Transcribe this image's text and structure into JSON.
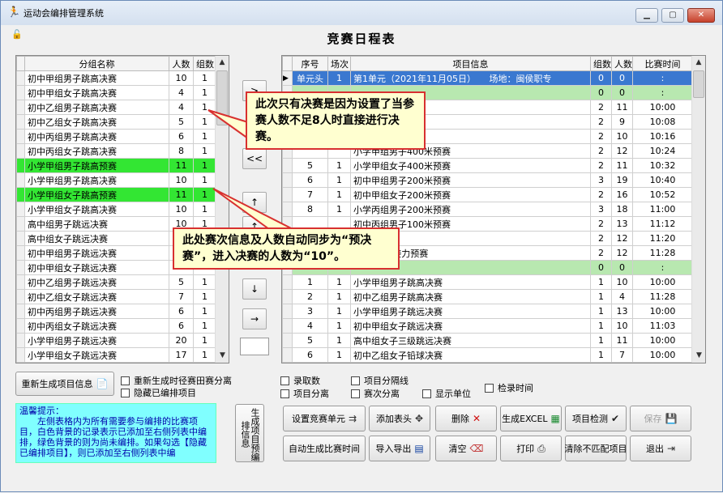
{
  "window": {
    "title": "运动会编排管理系统",
    "minimize": "▁",
    "maximize": "▢",
    "close": "✕",
    "lock": "🔓"
  },
  "heading": "竞赛日程表",
  "left_table": {
    "headers": [
      "分组名称",
      "人数",
      "组数"
    ],
    "rows": [
      {
        "name": "初中甲组男子跳高决赛",
        "count": "10",
        "groups": "1",
        "hl": ""
      },
      {
        "name": "初中甲组女子跳高决赛",
        "count": "4",
        "groups": "1",
        "hl": ""
      },
      {
        "name": "初中乙组男子跳高决赛",
        "count": "4",
        "groups": "1",
        "hl": ""
      },
      {
        "name": "初中乙组女子跳高决赛",
        "count": "5",
        "groups": "1",
        "hl": ""
      },
      {
        "name": "初中丙组男子跳高决赛",
        "count": "6",
        "groups": "1",
        "hl": ""
      },
      {
        "name": "初中丙组女子跳高决赛",
        "count": "8",
        "groups": "1",
        "hl": ""
      },
      {
        "name": "小学甲组男子跳高预赛",
        "count": "11",
        "groups": "1",
        "hl": "green"
      },
      {
        "name": "小学甲组男子跳高决赛",
        "count": "10",
        "groups": "1",
        "hl": ""
      },
      {
        "name": "小学甲组女子跳高预赛",
        "count": "11",
        "groups": "1",
        "hl": "green"
      },
      {
        "name": "小学甲组女子跳高决赛",
        "count": "10",
        "groups": "1",
        "hl": ""
      },
      {
        "name": "高中组男子跳远决赛",
        "count": "10",
        "groups": "1",
        "hl": ""
      },
      {
        "name": "高中组女子跳远决赛",
        "count": "",
        "groups": "",
        "hl": ""
      },
      {
        "name": "初中甲组男子跳远决赛",
        "count": "",
        "groups": "",
        "hl": ""
      },
      {
        "name": "初中甲组女子跳远决赛",
        "count": "",
        "groups": "",
        "hl": ""
      },
      {
        "name": "初中乙组男子跳远决赛",
        "count": "5",
        "groups": "1",
        "hl": ""
      },
      {
        "name": "初中乙组女子跳远决赛",
        "count": "7",
        "groups": "1",
        "hl": ""
      },
      {
        "name": "初中丙组男子跳远决赛",
        "count": "6",
        "groups": "1",
        "hl": ""
      },
      {
        "name": "初中丙组女子跳远决赛",
        "count": "6",
        "groups": "1",
        "hl": ""
      },
      {
        "name": "小学甲组男子跳远决赛",
        "count": "20",
        "groups": "1",
        "hl": ""
      },
      {
        "name": "小学甲组女子跳远决赛",
        "count": "17",
        "groups": "1",
        "hl": ""
      }
    ]
  },
  "move_buttons": [
    ">",
    "<<",
    "↑",
    "↑",
    "↓",
    "→"
  ],
  "right_table": {
    "headers": [
      "序号",
      "场次",
      "项目信息",
      "组数",
      "人数",
      "比赛时间"
    ],
    "rows": [
      {
        "no": "单元头",
        "session": "1",
        "info": "第1单元（2021年11月05日）　　场地：闽侯职专",
        "g": "0",
        "p": "0",
        "time": ":",
        "cls": "selrow",
        "marker": "▶"
      },
      {
        "no": "",
        "session": "",
        "info": "",
        "g": "0",
        "p": "0",
        "time": ":",
        "cls": "lightgreen",
        "marker": ""
      },
      {
        "no": "",
        "session": "",
        "info": "项全能[60米]决赛",
        "g": "2",
        "p": "11",
        "time": "10:00",
        "cls": "",
        "marker": ""
      },
      {
        "no": "",
        "session": "",
        "info": "项全能[60米]决赛",
        "g": "2",
        "p": "9",
        "time": "10:08",
        "cls": "",
        "marker": ""
      },
      {
        "no": "",
        "session": "",
        "info": "米预赛",
        "g": "2",
        "p": "10",
        "time": "10:16",
        "cls": "",
        "marker": ""
      },
      {
        "no": "",
        "session": "",
        "info": "小学甲组男子400米预赛",
        "g": "2",
        "p": "12",
        "time": "10:24",
        "cls": "",
        "marker": ""
      },
      {
        "no": "5",
        "session": "1",
        "info": "小学甲组女子400米预赛",
        "g": "2",
        "p": "11",
        "time": "10:32",
        "cls": "",
        "marker": ""
      },
      {
        "no": "6",
        "session": "1",
        "info": "初中甲组男子200米预赛",
        "g": "3",
        "p": "19",
        "time": "10:40",
        "cls": "",
        "marker": ""
      },
      {
        "no": "7",
        "session": "1",
        "info": "初中甲组女子200米预赛",
        "g": "2",
        "p": "16",
        "time": "10:52",
        "cls": "",
        "marker": ""
      },
      {
        "no": "8",
        "session": "1",
        "info": "小学丙组男子200米预赛",
        "g": "3",
        "p": "18",
        "time": "11:00",
        "cls": "",
        "marker": ""
      },
      {
        "no": "",
        "session": "",
        "info": "初中丙组男子100米预赛",
        "g": "2",
        "p": "13",
        "time": "11:12",
        "cls": "",
        "marker": ""
      },
      {
        "no": "",
        "session": "",
        "info": "100米预赛",
        "g": "2",
        "p": "12",
        "time": "11:20",
        "cls": "",
        "marker": ""
      },
      {
        "no": "",
        "session": "",
        "info": "4×100米接力预赛",
        "g": "2",
        "p": "12",
        "time": "11:28",
        "cls": "",
        "marker": ""
      },
      {
        "no": "",
        "session": "",
        "info": "",
        "g": "0",
        "p": "0",
        "time": ":",
        "cls": "lightgreen",
        "marker": ""
      },
      {
        "no": "1",
        "session": "1",
        "info": "小学甲组男子跳高决赛",
        "g": "1",
        "p": "10",
        "time": "10:00",
        "cls": "",
        "marker": ""
      },
      {
        "no": "2",
        "session": "1",
        "info": "初中乙组男子跳高决赛",
        "g": "1",
        "p": "4",
        "time": "11:28",
        "cls": "",
        "marker": ""
      },
      {
        "no": "3",
        "session": "1",
        "info": "小学甲组男子跳远决赛",
        "g": "1",
        "p": "13",
        "time": "10:00",
        "cls": "",
        "marker": ""
      },
      {
        "no": "4",
        "session": "1",
        "info": "初中甲组女子跳远决赛",
        "g": "1",
        "p": "10",
        "time": "11:03",
        "cls": "",
        "marker": ""
      },
      {
        "no": "5",
        "session": "1",
        "info": "高中组女子三级跳远决赛",
        "g": "1",
        "p": "11",
        "time": "10:00",
        "cls": "",
        "marker": ""
      },
      {
        "no": "6",
        "session": "1",
        "info": "初中乙组女子铅球决赛",
        "g": "1",
        "p": "7",
        "time": "10:00",
        "cls": "",
        "marker": ""
      }
    ]
  },
  "callouts": {
    "top": "此次只有决赛是因为设置了当参赛人数不足8人时直接进行决赛。",
    "bottom": "此处赛次信息及人数自动同步为“预决赛”，进入决赛的人数为“10”。"
  },
  "left_controls": {
    "regen_button": "重新生成项目信息",
    "regen_icon": "📄",
    "cb_regen_track": "重新生成时径赛田赛分离",
    "cb_hide_arranged": "隐藏已编排项目"
  },
  "right_checks": {
    "luqushu": "录取数",
    "xiangmu_sep_line": "项目分隔线",
    "check_time": "检录时间",
    "xiangmu_fenli": "项目分离",
    "saici_fenli": "赛次分离",
    "show_unit": "显示单位"
  },
  "hint": {
    "title": "温馨提示：",
    "body": "　　左侧表格内为所有需要参与编排的比赛项目，白色背景的记录表示已添加至右侧列表中编排，绿色背景的则为尚未编排。如果勾选【隐藏已编排项目】，则已添加至右侧列表中编"
  },
  "vertical_button": "生成项目预编排信息",
  "action_buttons": [
    {
      "label": "设置竞赛单元",
      "icon": "⇉"
    },
    {
      "label": "添加表头",
      "icon": "✥"
    },
    {
      "label": "删除",
      "icon": "✕"
    },
    {
      "label": "生成EXCEL",
      "icon": "▦"
    },
    {
      "label": "项目检测",
      "icon": "✔"
    },
    {
      "label": "保存",
      "icon": "💾"
    },
    {
      "label": "自动生成比赛时间",
      "icon": ""
    },
    {
      "label": "导入导出",
      "icon": "▤"
    },
    {
      "label": "清空",
      "icon": "⌫"
    },
    {
      "label": "打印",
      "icon": "⎙"
    },
    {
      "label": "清除不匹配项目",
      "icon": ""
    },
    {
      "label": "退出",
      "icon": "⇥"
    }
  ]
}
